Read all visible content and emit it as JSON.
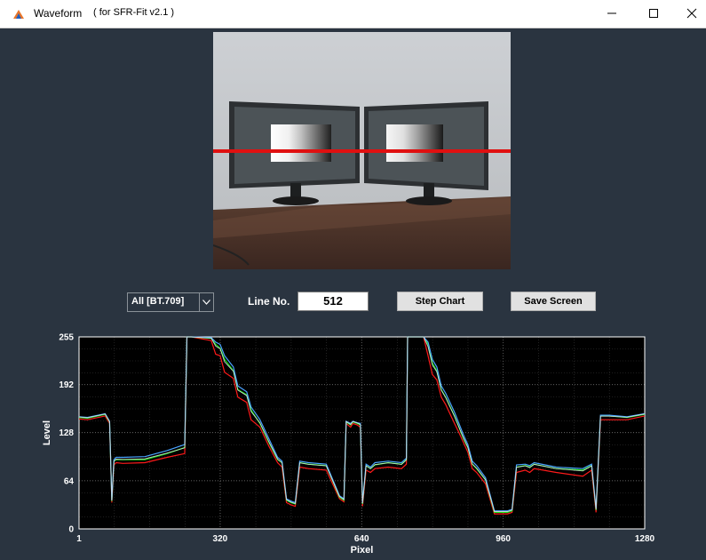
{
  "window": {
    "title": "Waveform",
    "subtitle": "( for SFR-Fit v2.1 )"
  },
  "controls": {
    "color_mode": "All [BT.709]",
    "line_label": "Line No.",
    "line_value": "512",
    "step_chart_label": "Step Chart",
    "save_screen_label": "Save Screen"
  },
  "icons": {
    "app": "matlab-icon",
    "minimize": "minimize-icon",
    "maximize": "maximize-icon",
    "close": "close-icon",
    "dropdown": "chevron-down-icon"
  },
  "colors": {
    "background": "#2a3440",
    "plot_background": "#000000",
    "scan_line": "#e01010",
    "red": "#ff1a1a",
    "green": "#19e619",
    "blue": "#4aa3ff",
    "luma": "#e6e6e6"
  },
  "chart_data": {
    "type": "line",
    "xlabel": "Pixel",
    "ylabel": "Level",
    "xlim": [
      1,
      1280
    ],
    "ylim": [
      0,
      255
    ],
    "xticks": [
      1,
      320,
      640,
      960,
      1280
    ],
    "yticks": [
      0,
      64,
      128,
      192,
      255
    ],
    "grid": true,
    "x": [
      1,
      20,
      60,
      70,
      75,
      80,
      85,
      100,
      150,
      200,
      240,
      245,
      250,
      255,
      300,
      310,
      320,
      330,
      350,
      360,
      380,
      390,
      410,
      430,
      450,
      460,
      470,
      480,
      490,
      500,
      520,
      560,
      590,
      600,
      605,
      615,
      620,
      630,
      637,
      642,
      650,
      660,
      670,
      700,
      730,
      741,
      744,
      748,
      780,
      790,
      800,
      810,
      820,
      830,
      850,
      860,
      870,
      880,
      890,
      900,
      920,
      940,
      960,
      970,
      980,
      990,
      1010,
      1020,
      1030,
      1080,
      1140,
      1160,
      1170,
      1180,
      1200,
      1240,
      1280
    ],
    "series": [
      {
        "color": "red",
        "values": [
          146,
          145,
          150,
          140,
          35,
          85,
          88,
          87,
          88,
          95,
          100,
          255,
          255,
          255,
          250,
          232,
          230,
          208,
          200,
          175,
          168,
          145,
          135,
          110,
          88,
          82,
          35,
          32,
          30,
          82,
          80,
          78,
          40,
          36,
          140,
          135,
          140,
          138,
          135,
          30,
          78,
          75,
          80,
          82,
          80,
          86,
          255,
          255,
          255,
          230,
          205,
          198,
          175,
          165,
          140,
          128,
          115,
          102,
          80,
          75,
          60,
          20,
          20,
          20,
          22,
          75,
          78,
          75,
          80,
          75,
          70,
          78,
          22,
          145,
          145,
          145,
          150
        ]
      },
      {
        "color": "green",
        "values": [
          148,
          147,
          152,
          142,
          37,
          90,
          92,
          92,
          92,
          100,
          108,
          255,
          255,
          255,
          253,
          245,
          240,
          225,
          210,
          185,
          178,
          158,
          140,
          115,
          92,
          88,
          38,
          35,
          33,
          88,
          86,
          84,
          42,
          38,
          142,
          138,
          142,
          140,
          138,
          33,
          84,
          80,
          85,
          88,
          86,
          92,
          255,
          255,
          255,
          245,
          220,
          210,
          185,
          175,
          150,
          135,
          120,
          108,
          86,
          80,
          65,
          22,
          22,
          22,
          24,
          82,
          84,
          82,
          86,
          80,
          78,
          84,
          25,
          150,
          150,
          148,
          152
        ]
      },
      {
        "color": "blue",
        "values": [
          149,
          148,
          153,
          143,
          38,
          92,
          95,
          95,
          96,
          104,
          112,
          255,
          255,
          255,
          254,
          248,
          245,
          230,
          215,
          190,
          182,
          162,
          145,
          120,
          95,
          90,
          40,
          37,
          35,
          90,
          88,
          86,
          44,
          40,
          143,
          140,
          143,
          141,
          140,
          35,
          86,
          82,
          88,
          90,
          88,
          94,
          255,
          255,
          255,
          248,
          225,
          215,
          190,
          180,
          155,
          140,
          125,
          112,
          90,
          84,
          68,
          24,
          24,
          24,
          26,
          85,
          86,
          84,
          88,
          82,
          80,
          86,
          27,
          151,
          151,
          149,
          153
        ]
      }
    ]
  }
}
